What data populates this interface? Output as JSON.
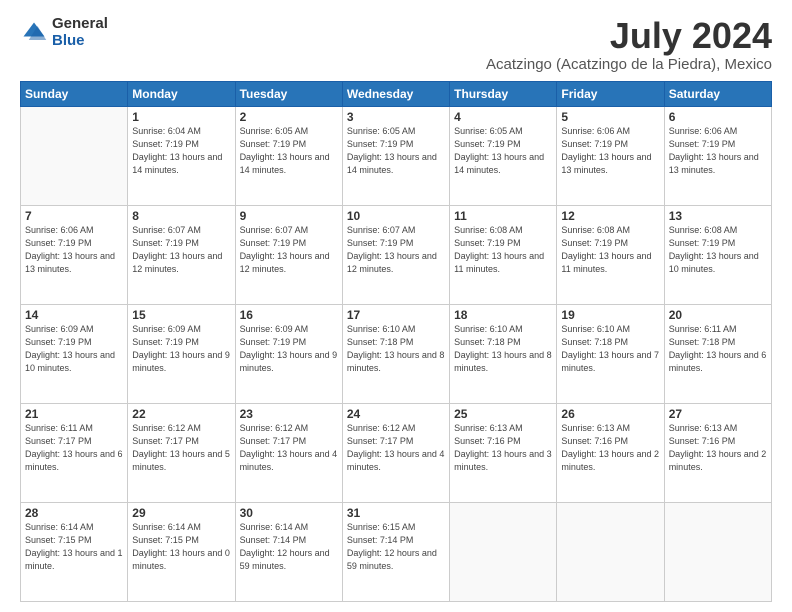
{
  "logo": {
    "general": "General",
    "blue": "Blue"
  },
  "header": {
    "month": "July 2024",
    "location": "Acatzingo (Acatzingo de la Piedra), Mexico"
  },
  "days_of_week": [
    "Sunday",
    "Monday",
    "Tuesday",
    "Wednesday",
    "Thursday",
    "Friday",
    "Saturday"
  ],
  "weeks": [
    [
      {
        "day": "",
        "sunrise": "",
        "sunset": "",
        "daylight": "",
        "empty": true
      },
      {
        "day": "1",
        "sunrise": "Sunrise: 6:04 AM",
        "sunset": "Sunset: 7:19 PM",
        "daylight": "Daylight: 13 hours and 14 minutes."
      },
      {
        "day": "2",
        "sunrise": "Sunrise: 6:05 AM",
        "sunset": "Sunset: 7:19 PM",
        "daylight": "Daylight: 13 hours and 14 minutes."
      },
      {
        "day": "3",
        "sunrise": "Sunrise: 6:05 AM",
        "sunset": "Sunset: 7:19 PM",
        "daylight": "Daylight: 13 hours and 14 minutes."
      },
      {
        "day": "4",
        "sunrise": "Sunrise: 6:05 AM",
        "sunset": "Sunset: 7:19 PM",
        "daylight": "Daylight: 13 hours and 14 minutes."
      },
      {
        "day": "5",
        "sunrise": "Sunrise: 6:06 AM",
        "sunset": "Sunset: 7:19 PM",
        "daylight": "Daylight: 13 hours and 13 minutes."
      },
      {
        "day": "6",
        "sunrise": "Sunrise: 6:06 AM",
        "sunset": "Sunset: 7:19 PM",
        "daylight": "Daylight: 13 hours and 13 minutes."
      }
    ],
    [
      {
        "day": "7",
        "sunrise": "Sunrise: 6:06 AM",
        "sunset": "Sunset: 7:19 PM",
        "daylight": "Daylight: 13 hours and 13 minutes."
      },
      {
        "day": "8",
        "sunrise": "Sunrise: 6:07 AM",
        "sunset": "Sunset: 7:19 PM",
        "daylight": "Daylight: 13 hours and 12 minutes."
      },
      {
        "day": "9",
        "sunrise": "Sunrise: 6:07 AM",
        "sunset": "Sunset: 7:19 PM",
        "daylight": "Daylight: 13 hours and 12 minutes."
      },
      {
        "day": "10",
        "sunrise": "Sunrise: 6:07 AM",
        "sunset": "Sunset: 7:19 PM",
        "daylight": "Daylight: 13 hours and 12 minutes."
      },
      {
        "day": "11",
        "sunrise": "Sunrise: 6:08 AM",
        "sunset": "Sunset: 7:19 PM",
        "daylight": "Daylight: 13 hours and 11 minutes."
      },
      {
        "day": "12",
        "sunrise": "Sunrise: 6:08 AM",
        "sunset": "Sunset: 7:19 PM",
        "daylight": "Daylight: 13 hours and 11 minutes."
      },
      {
        "day": "13",
        "sunrise": "Sunrise: 6:08 AM",
        "sunset": "Sunset: 7:19 PM",
        "daylight": "Daylight: 13 hours and 10 minutes."
      }
    ],
    [
      {
        "day": "14",
        "sunrise": "Sunrise: 6:09 AM",
        "sunset": "Sunset: 7:19 PM",
        "daylight": "Daylight: 13 hours and 10 minutes."
      },
      {
        "day": "15",
        "sunrise": "Sunrise: 6:09 AM",
        "sunset": "Sunset: 7:19 PM",
        "daylight": "Daylight: 13 hours and 9 minutes."
      },
      {
        "day": "16",
        "sunrise": "Sunrise: 6:09 AM",
        "sunset": "Sunset: 7:19 PM",
        "daylight": "Daylight: 13 hours and 9 minutes."
      },
      {
        "day": "17",
        "sunrise": "Sunrise: 6:10 AM",
        "sunset": "Sunset: 7:18 PM",
        "daylight": "Daylight: 13 hours and 8 minutes."
      },
      {
        "day": "18",
        "sunrise": "Sunrise: 6:10 AM",
        "sunset": "Sunset: 7:18 PM",
        "daylight": "Daylight: 13 hours and 8 minutes."
      },
      {
        "day": "19",
        "sunrise": "Sunrise: 6:10 AM",
        "sunset": "Sunset: 7:18 PM",
        "daylight": "Daylight: 13 hours and 7 minutes."
      },
      {
        "day": "20",
        "sunrise": "Sunrise: 6:11 AM",
        "sunset": "Sunset: 7:18 PM",
        "daylight": "Daylight: 13 hours and 6 minutes."
      }
    ],
    [
      {
        "day": "21",
        "sunrise": "Sunrise: 6:11 AM",
        "sunset": "Sunset: 7:17 PM",
        "daylight": "Daylight: 13 hours and 6 minutes."
      },
      {
        "day": "22",
        "sunrise": "Sunrise: 6:12 AM",
        "sunset": "Sunset: 7:17 PM",
        "daylight": "Daylight: 13 hours and 5 minutes."
      },
      {
        "day": "23",
        "sunrise": "Sunrise: 6:12 AM",
        "sunset": "Sunset: 7:17 PM",
        "daylight": "Daylight: 13 hours and 4 minutes."
      },
      {
        "day": "24",
        "sunrise": "Sunrise: 6:12 AM",
        "sunset": "Sunset: 7:17 PM",
        "daylight": "Daylight: 13 hours and 4 minutes."
      },
      {
        "day": "25",
        "sunrise": "Sunrise: 6:13 AM",
        "sunset": "Sunset: 7:16 PM",
        "daylight": "Daylight: 13 hours and 3 minutes."
      },
      {
        "day": "26",
        "sunrise": "Sunrise: 6:13 AM",
        "sunset": "Sunset: 7:16 PM",
        "daylight": "Daylight: 13 hours and 2 minutes."
      },
      {
        "day": "27",
        "sunrise": "Sunrise: 6:13 AM",
        "sunset": "Sunset: 7:16 PM",
        "daylight": "Daylight: 13 hours and 2 minutes."
      }
    ],
    [
      {
        "day": "28",
        "sunrise": "Sunrise: 6:14 AM",
        "sunset": "Sunset: 7:15 PM",
        "daylight": "Daylight: 13 hours and 1 minute."
      },
      {
        "day": "29",
        "sunrise": "Sunrise: 6:14 AM",
        "sunset": "Sunset: 7:15 PM",
        "daylight": "Daylight: 13 hours and 0 minutes."
      },
      {
        "day": "30",
        "sunrise": "Sunrise: 6:14 AM",
        "sunset": "Sunset: 7:14 PM",
        "daylight": "Daylight: 12 hours and 59 minutes."
      },
      {
        "day": "31",
        "sunrise": "Sunrise: 6:15 AM",
        "sunset": "Sunset: 7:14 PM",
        "daylight": "Daylight: 12 hours and 59 minutes."
      },
      {
        "day": "",
        "sunrise": "",
        "sunset": "",
        "daylight": "",
        "empty": true
      },
      {
        "day": "",
        "sunrise": "",
        "sunset": "",
        "daylight": "",
        "empty": true
      },
      {
        "day": "",
        "sunrise": "",
        "sunset": "",
        "daylight": "",
        "empty": true
      }
    ]
  ]
}
